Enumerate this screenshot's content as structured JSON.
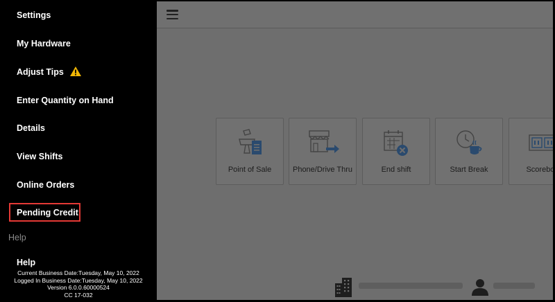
{
  "sidebar": {
    "items": [
      {
        "label": "Settings"
      },
      {
        "label": "My Hardware"
      },
      {
        "label": "Adjust Tips",
        "icon": "warning-icon"
      },
      {
        "label": "Enter Quantity on Hand"
      },
      {
        "label": "Details"
      },
      {
        "label": "View Shifts"
      },
      {
        "label": "Online Orders"
      },
      {
        "label": "Pending Credit",
        "highlighted": true
      }
    ],
    "section_label": "Help",
    "help_item": "Help",
    "footer": {
      "current_business_date": "Current Business Date:Tuesday, May 10, 2022",
      "logged_in_business_date": "Logged In Business Date:Tuesday, May 10, 2022",
      "version": "Version 6.0.0.60000524",
      "cc": "CC 17-032"
    }
  },
  "main": {
    "menu_icon": "hamburger-icon",
    "tiles": [
      {
        "label": "Point of Sale",
        "icon": "point-of-sale-icon"
      },
      {
        "label": "Phone/Drive Thru",
        "icon": "store-arrow-icon"
      },
      {
        "label": "End shift",
        "icon": "calendar-x-icon"
      },
      {
        "label": "Start Break",
        "icon": "clock-coffee-icon"
      },
      {
        "label": "Scoreboa",
        "icon": "scoreboard-icon"
      }
    ],
    "status_icons": [
      "building-icon",
      "person-icon"
    ]
  },
  "colors": {
    "sidebar_bg": "#000000",
    "overlay": "#6e6e6e",
    "highlight": "#e53935",
    "warning": "#f2b705",
    "icon_blue": "#2a4a6e"
  }
}
